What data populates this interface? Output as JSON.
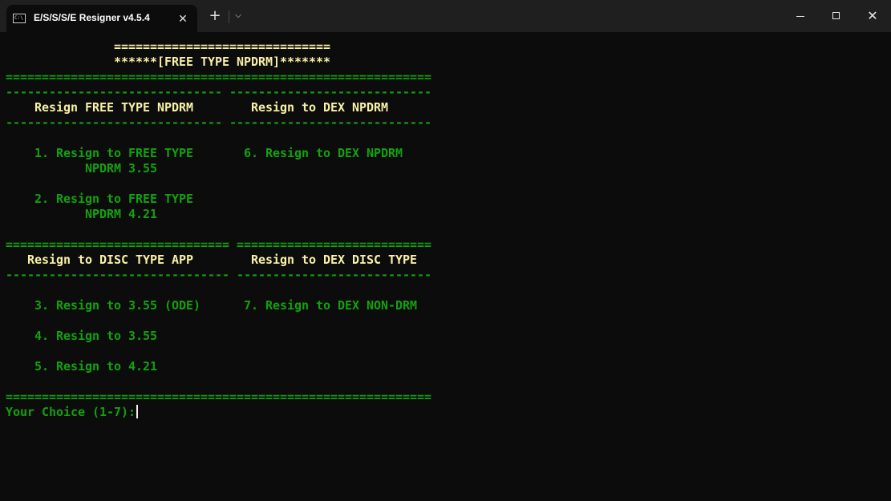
{
  "window": {
    "tab_title": "E/S/S/S/E Resigner v4.5.4",
    "tab_icon_text": "C:\\",
    "tab_icon": "terminal-icon",
    "close_tab_glyph": "✕",
    "new_tab_glyph": "+",
    "dropdown_glyph": "⌵",
    "minimize_icon": "minimize-icon",
    "maximize_icon": "maximize-icon",
    "close_glyph": "✕"
  },
  "colors": {
    "background": "#0c0c0c",
    "heading_yellow": "#f9f1a5",
    "menu_green": "#13a10e"
  },
  "terminal": {
    "lines": [
      {
        "text": "               ==============================",
        "color": "yellow"
      },
      {
        "text": "               ******[FREE TYPE NPDRM]*******",
        "color": "yellow"
      },
      {
        "text": "===========================================================",
        "color": "green"
      },
      {
        "text": "------------------------------ ----------------------------",
        "color": "green"
      },
      {
        "text": "    Resign FREE TYPE NPDRM        Resign to DEX NPDRM",
        "color": "yellow"
      },
      {
        "text": "------------------------------ ----------------------------",
        "color": "green"
      },
      {
        "text": "",
        "color": "green"
      },
      {
        "text": "    1. Resign to FREE TYPE       6. Resign to DEX NPDRM",
        "color": "green"
      },
      {
        "text": "           NPDRM 3.55",
        "color": "green"
      },
      {
        "text": "",
        "color": "green"
      },
      {
        "text": "    2. Resign to FREE TYPE",
        "color": "green"
      },
      {
        "text": "           NPDRM 4.21",
        "color": "green"
      },
      {
        "text": "",
        "color": "green"
      },
      {
        "text": "=============================== ===========================",
        "color": "green"
      },
      {
        "text": "   Resign to DISC TYPE APP        Resign to DEX DISC TYPE",
        "color": "yellow"
      },
      {
        "text": "------------------------------- ---------------------------",
        "color": "green"
      },
      {
        "text": "",
        "color": "green"
      },
      {
        "text": "    3. Resign to 3.55 (ODE)      7. Resign to DEX NON-DRM",
        "color": "green"
      },
      {
        "text": "",
        "color": "green"
      },
      {
        "text": "    4. Resign to 3.55",
        "color": "green"
      },
      {
        "text": "",
        "color": "green"
      },
      {
        "text": "    5. Resign to 4.21",
        "color": "green"
      },
      {
        "text": "",
        "color": "green"
      },
      {
        "text": "===========================================================",
        "color": "green"
      }
    ],
    "prompt": "Your Choice (1-7):"
  }
}
